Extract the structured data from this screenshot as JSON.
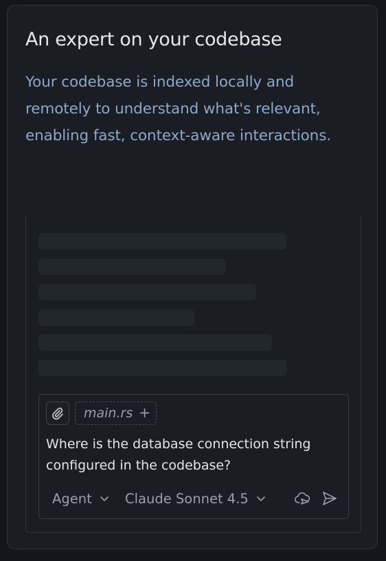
{
  "card": {
    "title": "An expert on your codebase",
    "description": "Your codebase is indexed locally and remotely to understand what's relevant, enabling fast, context-aware interactions."
  },
  "chat": {
    "attach_icon": "paperclip-icon",
    "file_chip": {
      "name": "main.rs",
      "add_symbol": "+"
    },
    "message": "Where is the database connection string configured in the codebase?",
    "mode_label": "Agent",
    "model_label": "Claude Sonnet 4.5",
    "cloud_icon": "cloud-send-icon",
    "send_icon": "send-icon"
  },
  "colors": {
    "background": "#14161b",
    "card": "#1a1d23",
    "title": "#e6e8ec",
    "description": "#8ea8cc",
    "skeleton": "#22262d",
    "muted_text": "#9aa0aa"
  }
}
